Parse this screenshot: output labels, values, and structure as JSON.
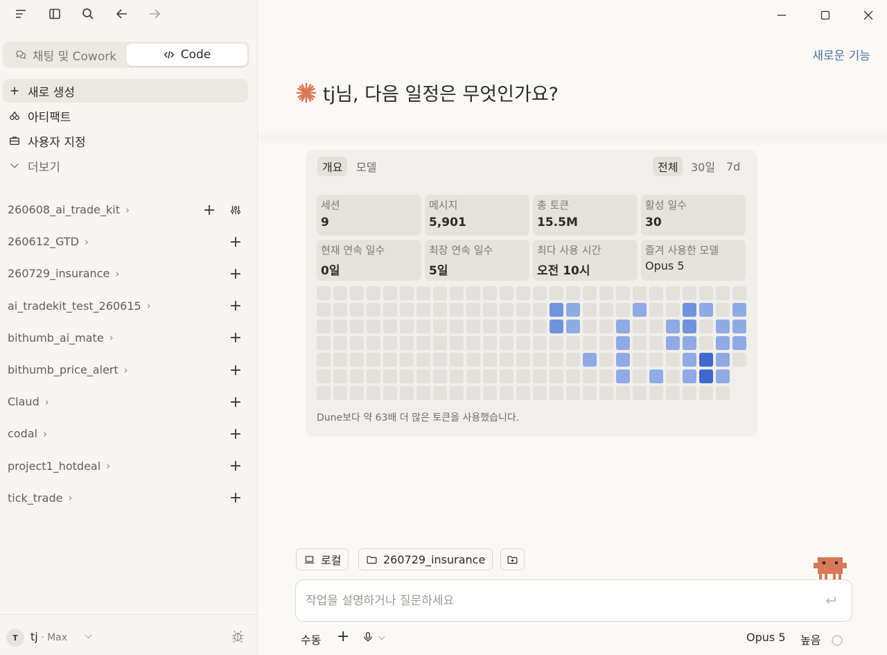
{
  "sidebar": {
    "mode_tabs": [
      {
        "label": "채팅 및 Cowork",
        "active": false
      },
      {
        "label": "Code",
        "active": true
      }
    ],
    "nav": {
      "new": "새로 생성",
      "artifacts": "아티팩트",
      "customize": "사용자 지정",
      "more": "더보기"
    },
    "projects": [
      {
        "name": "260608_ai_trade_kit"
      },
      {
        "name": "260612_GTD"
      },
      {
        "name": "260729_insurance"
      },
      {
        "name": "ai_tradekit_test_260615"
      },
      {
        "name": "bithumb_ai_mate"
      },
      {
        "name": "bithumb_price_alert"
      },
      {
        "name": "Claud"
      },
      {
        "name": "codal"
      },
      {
        "name": "project1_hotdeal"
      },
      {
        "name": "tick_trade"
      }
    ],
    "user": {
      "initial": "T",
      "name": "tj",
      "plan": " · Max"
    }
  },
  "main": {
    "whats_new": "새로운 기능",
    "greeting": "tj님, 다음 일정은 무엇인가요?",
    "stats": {
      "tabs": {
        "overview": "개요",
        "models": "모델"
      },
      "ranges": {
        "all": "전체",
        "d30": "30일",
        "d7": "7d"
      },
      "cards": [
        {
          "label": "세션",
          "value": "9"
        },
        {
          "label": "메시지",
          "value": "5,901"
        },
        {
          "label": "총 토큰",
          "value": "15.5M"
        },
        {
          "label": "활성 일수",
          "value": "30"
        },
        {
          "label": "현재 연속 일수",
          "value": "0일"
        },
        {
          "label": "최장 연속 일수",
          "value": "5일"
        },
        {
          "label": "최다 사용 시간",
          "value": "오전 10시"
        },
        {
          "label": "즐겨 사용한 모델",
          "value": "Opus 5"
        }
      ],
      "heatmap": {
        "columns": 26,
        "rows": 7,
        "last_column_rows": 5,
        "active_cells": [
          {
            "col": 14,
            "row": 1,
            "level": 2
          },
          {
            "col": 15,
            "row": 1,
            "level": 1
          },
          {
            "col": 19,
            "row": 1,
            "level": 1
          },
          {
            "col": 22,
            "row": 1,
            "level": 2
          },
          {
            "col": 23,
            "row": 1,
            "level": 1
          },
          {
            "col": 25,
            "row": 1,
            "level": 1
          },
          {
            "col": 14,
            "row": 2,
            "level": 2
          },
          {
            "col": 15,
            "row": 2,
            "level": 1
          },
          {
            "col": 18,
            "row": 2,
            "level": 1
          },
          {
            "col": 21,
            "row": 2,
            "level": 1
          },
          {
            "col": 22,
            "row": 2,
            "level": 2
          },
          {
            "col": 24,
            "row": 2,
            "level": 1
          },
          {
            "col": 25,
            "row": 2,
            "level": 1
          },
          {
            "col": 18,
            "row": 3,
            "level": 1
          },
          {
            "col": 21,
            "row": 3,
            "level": 1
          },
          {
            "col": 22,
            "row": 3,
            "level": 1
          },
          {
            "col": 24,
            "row": 3,
            "level": 1
          },
          {
            "col": 25,
            "row": 3,
            "level": 1
          },
          {
            "col": 16,
            "row": 4,
            "level": 1
          },
          {
            "col": 18,
            "row": 4,
            "level": 1
          },
          {
            "col": 22,
            "row": 4,
            "level": 1
          },
          {
            "col": 23,
            "row": 4,
            "level": 3
          },
          {
            "col": 24,
            "row": 4,
            "level": 1
          },
          {
            "col": 18,
            "row": 5,
            "level": 1
          },
          {
            "col": 20,
            "row": 5,
            "level": 1
          },
          {
            "col": 22,
            "row": 5,
            "level": 1
          },
          {
            "col": 23,
            "row": 5,
            "level": 3
          },
          {
            "col": 24,
            "row": 5,
            "level": 1
          }
        ]
      },
      "footnote": "Dune보다 약 63배 더 많은 토큰을 사용했습니다."
    },
    "composer": {
      "env_chip": "로컬",
      "folder_chip": "260729_insurance",
      "placeholder": "작업을 설명하거나 질문하세요",
      "mode": "수동",
      "model": "Opus 5",
      "effort": "높음"
    }
  },
  "colors": {
    "accent_link": "#4a6fa5",
    "brand_spark": "#d97757",
    "heat_empty": "#e3e1dc",
    "heat_l1": "#8fabe6",
    "heat_l2": "#6f93dd",
    "heat_l3": "#3f69cc"
  }
}
